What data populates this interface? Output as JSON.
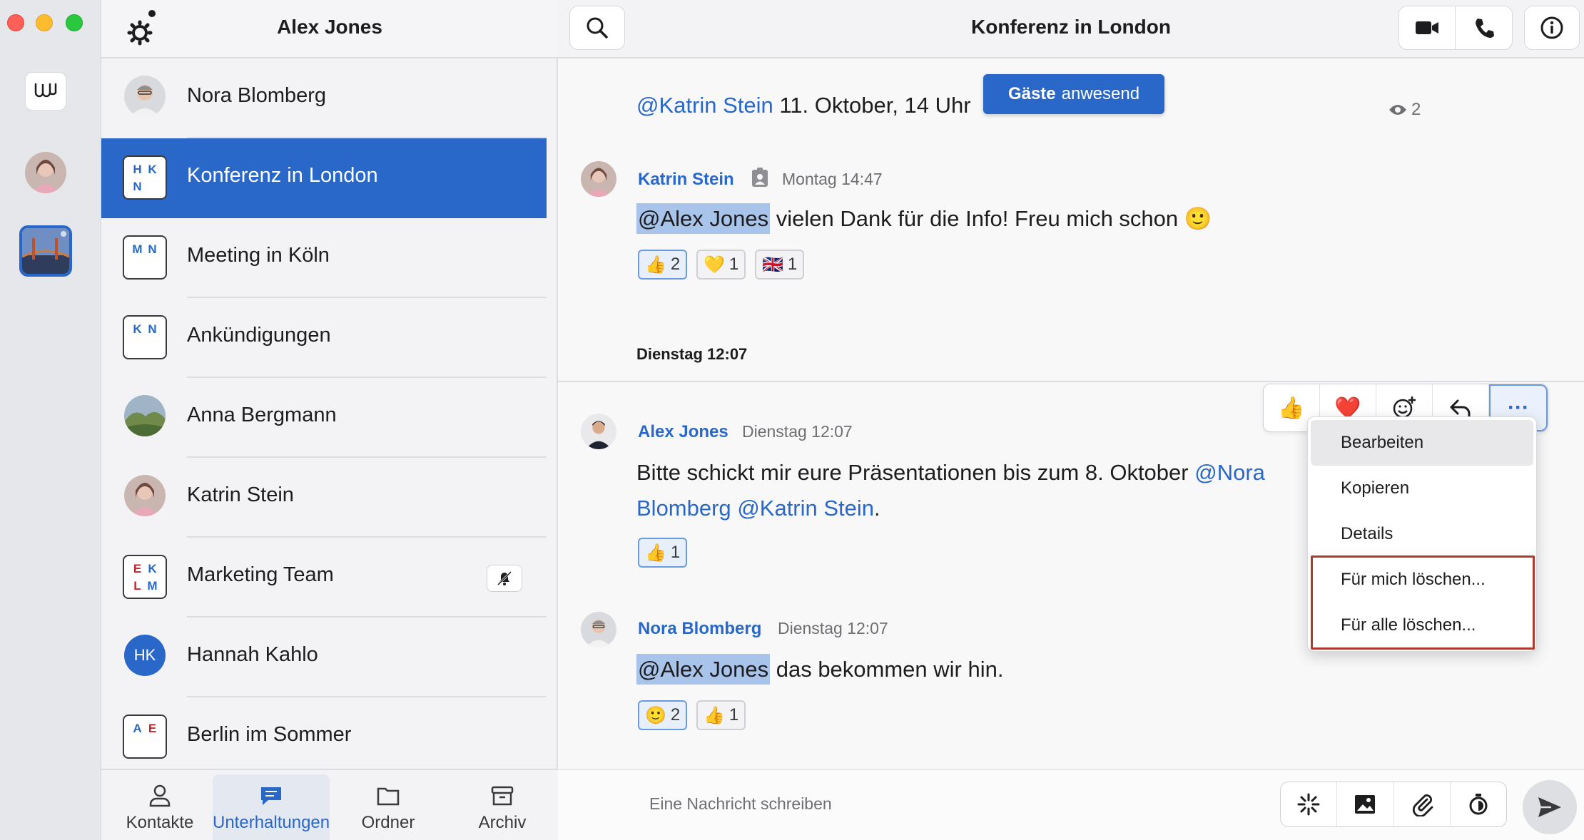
{
  "sidebar": {
    "title": "Alex Jones",
    "conversations": [
      {
        "name": "Nora Blomberg"
      },
      {
        "name": "Konferenz in London",
        "initials": [
          "H",
          "K",
          "N"
        ]
      },
      {
        "name": "Meeting in Köln",
        "initials": [
          "M",
          "N"
        ]
      },
      {
        "name": "Ankündigungen",
        "initials": [
          "K",
          "N"
        ]
      },
      {
        "name": "Anna Bergmann"
      },
      {
        "name": "Katrin Stein"
      },
      {
        "name": "Marketing Team",
        "initials": [
          "E",
          "K",
          "L",
          "M"
        ]
      },
      {
        "name": "Hannah Kahlo",
        "initials_text": "HK"
      },
      {
        "name": "Berlin im Sommer",
        "initials": [
          "A",
          "E"
        ]
      }
    ],
    "nav": {
      "contacts": "Kontakte",
      "conversations": "Unterhaltungen",
      "folders": "Ordner",
      "archive": "Archiv"
    }
  },
  "main": {
    "title": "Konferenz in London",
    "guest_pill_bold": "Gäste",
    "guest_pill_rest": "anwesend",
    "prev_message": {
      "mention": "@Katrin Stein",
      "text": " 11. Oktober, 14 Uhr",
      "seen_count": "2"
    },
    "messages": [
      {
        "author": "Katrin Stein",
        "time": "Montag 14:47",
        "mention": "@Alex Jones",
        "text": " vielen Dank für die Info! Freu mich schon 🙂",
        "reactions": [
          {
            "emoji": "👍",
            "count": "2"
          },
          {
            "emoji": "💛",
            "count": "1"
          },
          {
            "emoji": "🇬🇧",
            "count": "1"
          }
        ]
      },
      {
        "author": "Alex Jones",
        "time": "Dienstag 12:07",
        "text1": "Bitte schickt mir eure Präsentationen bis zum 8. Oktober ",
        "mention1": "@Nora",
        "mention1b": "Blomberg",
        "mention2": "@Katrin Stein",
        "text_end": ".",
        "reactions": [
          {
            "emoji": "👍",
            "count": "1"
          }
        ]
      },
      {
        "author": "Nora Blomberg",
        "time": "Dienstag 12:07",
        "mention": "@Alex Jones",
        "text": " das bekommen wir hin.",
        "reactions": [
          {
            "emoji": "🙂",
            "count": "2"
          },
          {
            "emoji": "👍",
            "count": "1"
          }
        ]
      }
    ],
    "day_separator": "Dienstag 12:07",
    "hover_actions": {
      "thumbs": "👍",
      "heart": "❤️",
      "more": "···"
    },
    "context_menu": [
      "Bearbeiten",
      "Kopieren",
      "Details",
      "Für mich löschen...",
      "Für alle löschen..."
    ],
    "composer_placeholder": "Eine Nachricht schreiben"
  },
  "colors": {
    "accent": "#2968c8",
    "danger_outline": "#b03a2e"
  }
}
